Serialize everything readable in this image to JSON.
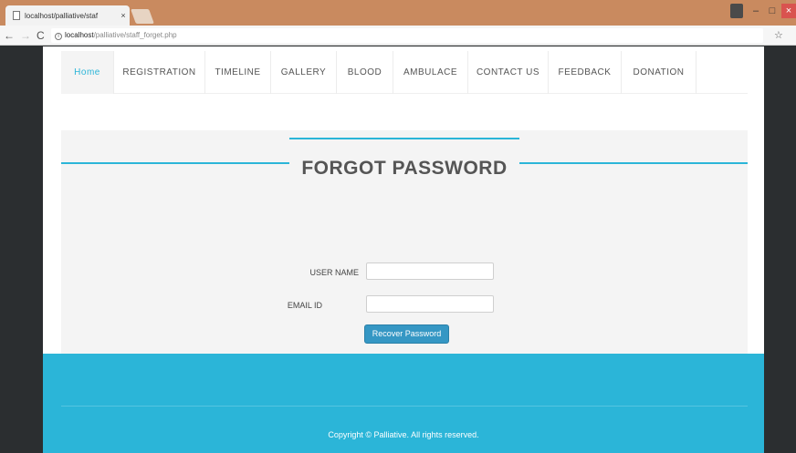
{
  "browser": {
    "tab_title": "localhost/palliative/staf",
    "tab_close": "×",
    "url_host": "localhost",
    "url_path": "/palliative/staff_forget.php",
    "icons": {
      "back": "←",
      "forward": "→",
      "reload": "C",
      "star": "☆",
      "info": "i"
    },
    "window_controls": {
      "minimize": "–",
      "maximize": "□",
      "close": "×"
    }
  },
  "menu": [
    {
      "label": "Home",
      "width": 58
    },
    {
      "label": "REGISTRATION",
      "width": 100
    },
    {
      "label": "TIMELINE",
      "width": 72
    },
    {
      "label": "GALLERY",
      "width": 72
    },
    {
      "label": "BLOOD",
      "width": 62
    },
    {
      "label": "AMBULACE",
      "width": 82
    },
    {
      "label": "CONTACT US",
      "width": 88
    },
    {
      "label": "FEEDBACK",
      "width": 80
    },
    {
      "label": "DONATION",
      "width": 82
    }
  ],
  "form": {
    "title": "FORGOT PASSWORD",
    "username_label": "USER NAME",
    "username_value": "",
    "email_label": "EMAIL ID",
    "email_value": "",
    "submit_label": "Recover Password"
  },
  "footer": {
    "copyright": "Copyright © Palliative. All rights reserved."
  },
  "colors": {
    "accent": "#2bb5d8",
    "button": "#3597c4"
  }
}
